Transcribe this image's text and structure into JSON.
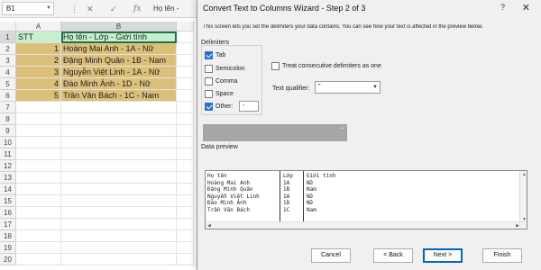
{
  "formula_bar": {
    "name_box": "B1",
    "formula_text": "Họ tên -",
    "icons": [
      "cancel-icon",
      "enter-icon",
      "function-icon"
    ]
  },
  "sheet": {
    "columns": [
      "A",
      "B"
    ],
    "rows": [
      "1",
      "2",
      "3",
      "4",
      "5",
      "6",
      "7",
      "8",
      "9",
      "10",
      "11",
      "12",
      "13",
      "14",
      "15",
      "16",
      "17",
      "18",
      "19",
      "20"
    ],
    "cells": {
      "A1": "STT",
      "B1": "Họ tên - Lớp - Giới tính",
      "A2": "1",
      "B2": "Hoàng Mai Anh - 1A - Nữ",
      "A3": "2",
      "B3": "Đặng Minh Quân - 1B - Nam",
      "A4": "3",
      "B4": "Nguyễn Việt Linh - 1A - Nữ",
      "A5": "4",
      "B5": "Đào Minh Ánh - 1D - Nữ",
      "A6": "5",
      "B6": "Trần Văn Bách - 1C - Nam"
    },
    "colors": {
      "header_fill": "#c6efce",
      "data_fill": "#dcc07a",
      "selection": "#217346"
    }
  },
  "dialog": {
    "title": "Convert Text to Columns Wizard - Step 2 of 3",
    "help": "?",
    "close": "✕",
    "description": "This screen lets you set the delimiters your data contains.  You can see how your text is affected in the preview below.",
    "delimiters_label": "Delimiters",
    "delimiters": [
      {
        "label": "Tab",
        "checked": true
      },
      {
        "label": "Semicolon",
        "checked": false
      },
      {
        "label": "Comma",
        "checked": false
      },
      {
        "label": "Space",
        "checked": false
      },
      {
        "label": "Other:",
        "checked": true,
        "value": "-"
      }
    ],
    "consecutive": {
      "label": "Treat consecutive delimiters as one",
      "checked": false
    },
    "qualifier": {
      "label": "Text qualifier:",
      "value": "\""
    },
    "preview_label": "Data preview",
    "preview_columns": [
      [
        "Họ tên",
        "Hoàng Mai Anh",
        "Đặng Minh Quân",
        "Nguyễn Việt Linh",
        "Đào Minh Ánh",
        "Trần Văn Bách"
      ],
      [
        "Lớp",
        "1A",
        "1B",
        "1A",
        "1D",
        "1C"
      ],
      [
        "Giới tính",
        "Nữ",
        "Nam",
        "Nữ",
        "Nữ",
        "Nam"
      ]
    ],
    "buttons": {
      "cancel": "Cancel",
      "back": "< Back",
      "next": "Next >",
      "finish": "Finish"
    },
    "accent": "#2a6fd6"
  }
}
